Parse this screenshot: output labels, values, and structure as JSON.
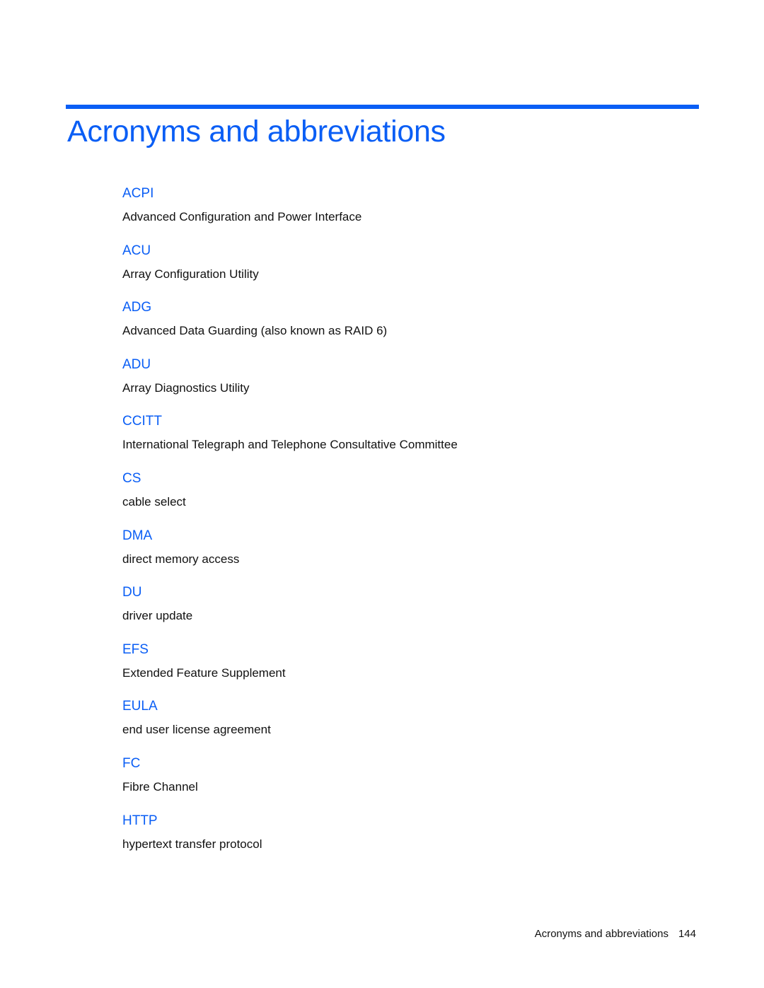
{
  "page": {
    "title": "Acronyms and abbreviations",
    "accent_color": "#0a5ef5",
    "entries": [
      {
        "term": "ACPI",
        "definition": "Advanced Configuration and Power Interface"
      },
      {
        "term": "ACU",
        "definition": "Array Configuration Utility"
      },
      {
        "term": "ADG",
        "definition": "Advanced Data Guarding (also known as RAID 6)"
      },
      {
        "term": "ADU",
        "definition": "Array Diagnostics Utility"
      },
      {
        "term": "CCITT",
        "definition": "International Telegraph and Telephone Consultative Committee"
      },
      {
        "term": "CS",
        "definition": "cable select"
      },
      {
        "term": "DMA",
        "definition": "direct memory access"
      },
      {
        "term": "DU",
        "definition": "driver update"
      },
      {
        "term": "EFS",
        "definition": "Extended Feature Supplement"
      },
      {
        "term": "EULA",
        "definition": "end user license agreement"
      },
      {
        "term": "FC",
        "definition": "Fibre Channel"
      },
      {
        "term": "HTTP",
        "definition": "hypertext transfer protocol"
      }
    ],
    "footer": {
      "section": "Acronyms and abbreviations",
      "page_number": "144"
    }
  }
}
